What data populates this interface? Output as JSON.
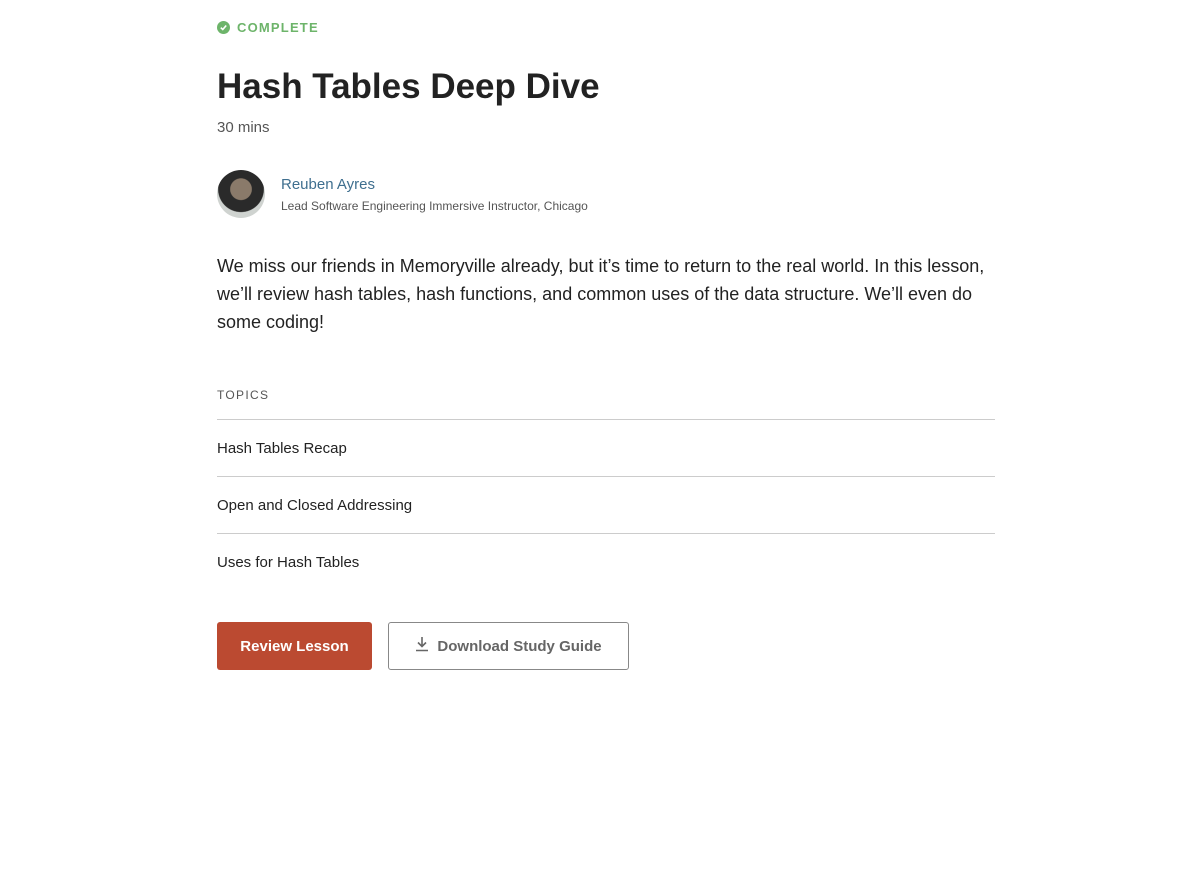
{
  "status": {
    "label": "COMPLETE",
    "color": "#6db46a",
    "icon": "check-circle-icon"
  },
  "lesson": {
    "title": "Hash Tables Deep Dive",
    "duration": "30 mins",
    "description": "We miss our friends in Memoryville already, but it’s time to return to the real world. In this lesson, we’ll review hash tables, hash functions, and common uses of the data structure. We’ll even do some coding!"
  },
  "instructor": {
    "name": "Reuben Ayres",
    "title": "Lead Software Engineering Immersive Instructor, Chicago"
  },
  "topics": {
    "label": "TOPICS",
    "items": [
      "Hash Tables Recap",
      "Open and Closed Addressing",
      "Uses for Hash Tables"
    ]
  },
  "actions": {
    "review": "Review Lesson",
    "download": "Download Study Guide",
    "accent": "#bb4a31"
  }
}
